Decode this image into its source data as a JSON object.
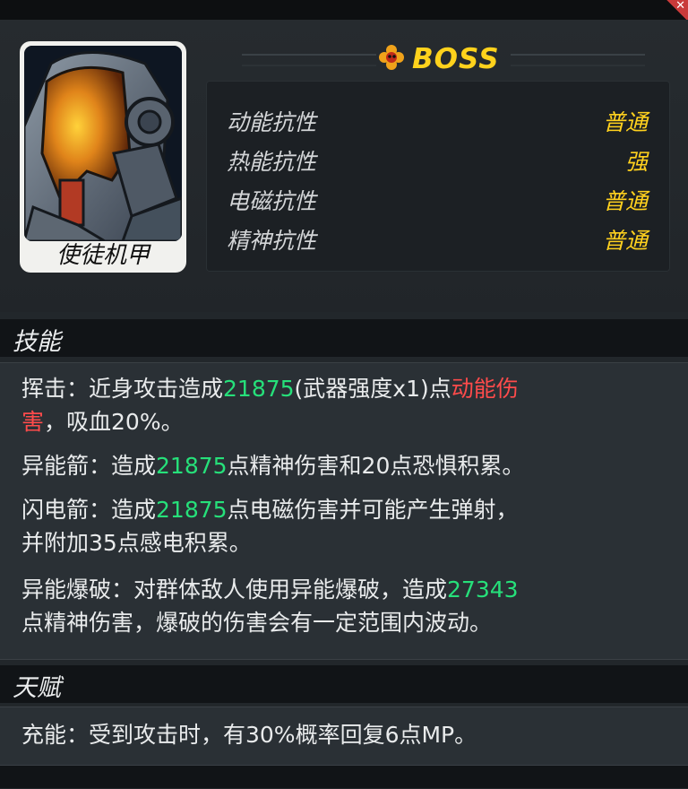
{
  "unit": {
    "name": "使徒机甲",
    "rank": "BOSS"
  },
  "resistances": [
    {
      "label": "动能抗性",
      "value": "普通"
    },
    {
      "label": "热能抗性",
      "value": "强"
    },
    {
      "label": "电磁抗性",
      "value": "普通"
    },
    {
      "label": "精神抗性",
      "value": "普通"
    }
  ],
  "skills_section": {
    "title": "技能",
    "skills": [
      {
        "line1_a": "挥击：近身攻击造成",
        "line1_value": "21875",
        "line1_b": "(武器强度x1)点",
        "line1_type": "动能伤",
        "line2_type": "害",
        "line2_rest": "，吸血20%。"
      },
      {
        "a": "异能箭：造成",
        "value": "21875",
        "b": "点精神伤害和20点恐惧积累。"
      },
      {
        "a": "闪电箭：造成",
        "value": "21875",
        "b": "点电磁伤害并可能产生弹射，",
        "line2": "并附加35点感电积累。"
      },
      {
        "a": "异能爆破：对群体敌人使用异能爆破，造成",
        "value": "27343",
        "line2": "点精神伤害，爆破的伤害会有一定范围内波动。"
      }
    ]
  },
  "talent_section": {
    "title": "天赋",
    "text": "充能：受到攻击时，有30%概率回复6点MP。"
  },
  "colors": {
    "damage_value": "#26e07a",
    "damage_type": "#ff4b4b",
    "resist_value": "#ffd11e",
    "boss": "#ffd21c"
  },
  "icons": [
    "boss-flower-icon",
    "close-icon"
  ]
}
